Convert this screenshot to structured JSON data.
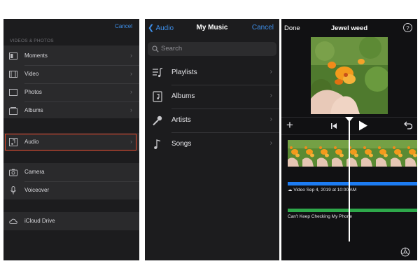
{
  "source_panel": {
    "cancel_label": "Cancel",
    "section_label": "VIDEOS & PHOTOS",
    "items": [
      {
        "label": "Moments",
        "icon": "moments-icon"
      },
      {
        "label": "Video",
        "icon": "film-icon"
      },
      {
        "label": "Photos",
        "icon": "photo-icon"
      },
      {
        "label": "Albums",
        "icon": "albums-icon"
      },
      {
        "label": "Audio",
        "icon": "music-note-icon"
      },
      {
        "label": "Camera",
        "icon": "camera-icon"
      },
      {
        "label": "Voiceover",
        "icon": "microphone-icon"
      },
      {
        "label": "iCloud Drive",
        "icon": "cloud-icon"
      }
    ],
    "highlight_color": "#e8472a"
  },
  "music_panel": {
    "back_label": "Audio",
    "title": "My Music",
    "cancel_label": "Cancel",
    "search_placeholder": "Search",
    "items": [
      {
        "label": "Playlists",
        "icon": "playlist-icon"
      },
      {
        "label": "Albums",
        "icon": "album-icon"
      },
      {
        "label": "Artists",
        "icon": "microphone-icon"
      },
      {
        "label": "Songs",
        "icon": "music-note-icon"
      }
    ],
    "accent_color": "#3d8ee8"
  },
  "editor_panel": {
    "done_label": "Done",
    "title": "Jewel weed",
    "help_label": "?",
    "plus_label": "+",
    "video_caption": "Video Sep 4, 2019 at 10:00 AM",
    "audio_caption": "Can't Keep Checking My Phone",
    "video_track_color": "#1d7cf2",
    "audio_track_color": "#2ea84a"
  }
}
